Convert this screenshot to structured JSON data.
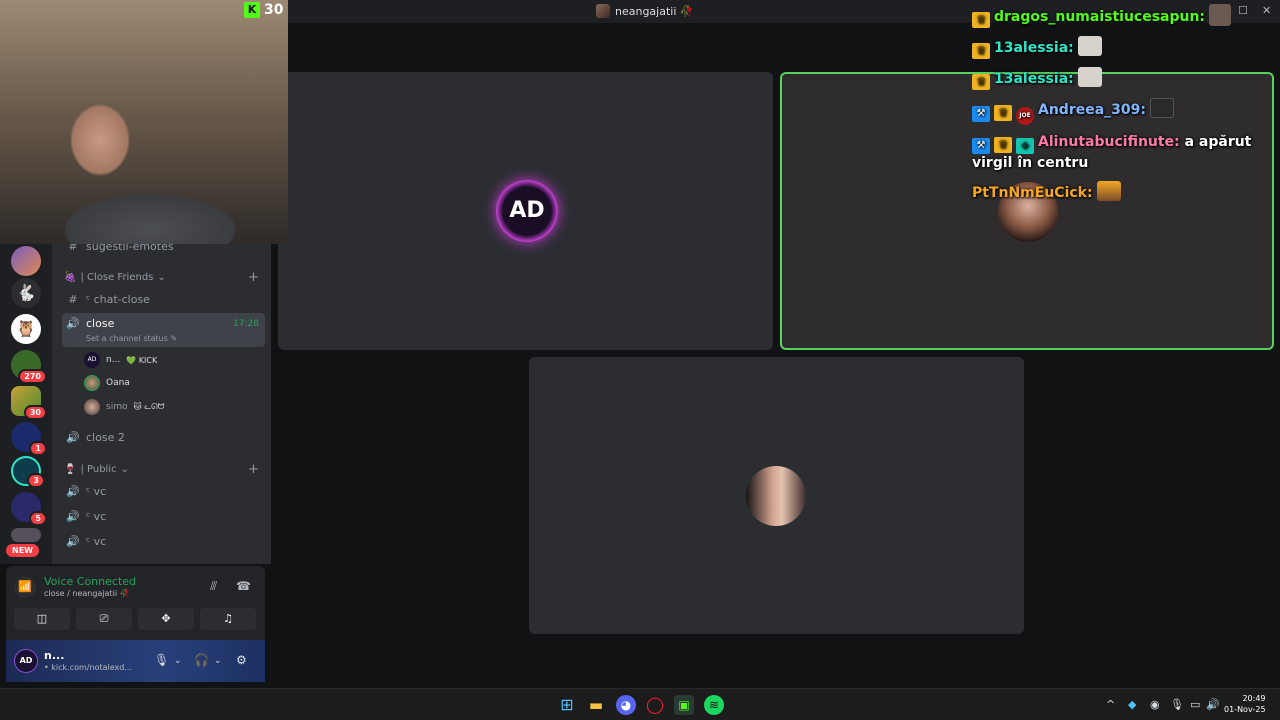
{
  "window": {
    "title": "neangajatii 🥀"
  },
  "webcam": {
    "kick_count": "30",
    "kick_letter": "K"
  },
  "servers": [
    {
      "name": "server-1",
      "badge": ""
    },
    {
      "name": "server-2",
      "badge": ""
    },
    {
      "name": "server-3",
      "badge": ""
    },
    {
      "name": "server-4",
      "badge": "270"
    },
    {
      "name": "server-5",
      "badge": "30"
    },
    {
      "name": "server-6",
      "badge": "1"
    },
    {
      "name": "server-7",
      "badge": "3"
    },
    {
      "name": "server-8",
      "badge": "5"
    }
  ],
  "new_badge": "NEW",
  "channels": {
    "partial_top": "sugestii-emotes",
    "category_close": "| Close Friends",
    "chat_close": "ᶜ chat-close",
    "close_voice": {
      "label": "close",
      "time": "17:28",
      "status": "Set a channel status"
    },
    "users": [
      {
        "name": "n...",
        "tag": "💚 KICK"
      },
      {
        "name": "Oana",
        "tag": ""
      },
      {
        "name": "simo",
        "tag": "🐱 ᓚᘏᗢ"
      }
    ],
    "close2": "close 2",
    "category_public": "| Public",
    "vc_list": [
      "ᶜ vc",
      "ᶜ vc",
      "ᶜ vc"
    ]
  },
  "voice": {
    "status": "Voice Connected",
    "location": "close / neangajatii 🥀",
    "buttons": [
      "camera-off",
      "screen-share",
      "activities",
      "soundboard"
    ]
  },
  "user_panel": {
    "name": "n...",
    "status": "• kick.com/notalexd...",
    "avatar_text": "AD"
  },
  "tiles": {
    "tile1_avatar_text": "AD"
  },
  "chat": [
    {
      "badges": [
        "crown"
      ],
      "user": "dragos_numaistiucesapun:",
      "color": "#53fc18",
      "text": "",
      "emote": "pfp"
    },
    {
      "badges": [
        "crown"
      ],
      "user": "13alessia:",
      "color": "#2ee6c8",
      "text": "",
      "emote": "cat"
    },
    {
      "badges": [
        "crown"
      ],
      "user": "13alessia:",
      "color": "#2ee6c8",
      "text": "",
      "emote": "cat"
    },
    {
      "badges": [
        "mod",
        "crown",
        "joe"
      ],
      "user": "Andreea_309:",
      "color": "#7fb6ff",
      "text": "",
      "emote": "cinema"
    },
    {
      "badges": [
        "mod",
        "crown",
        "vip"
      ],
      "user": "Alinutabucifinute:",
      "color": "#ff7aa8",
      "text": "a apărut virgil în centru",
      "emote": ""
    },
    {
      "badges": [],
      "user": "PtTnNmEuCick:",
      "color": "#f5a623",
      "text": "",
      "emote": "sun"
    }
  ],
  "clock": {
    "time": "20:49",
    "date": "01-Nov-25"
  },
  "colors": {
    "accent_green": "#23a559",
    "speaking_border": "#57d25c",
    "kick_green": "#53fc18"
  }
}
